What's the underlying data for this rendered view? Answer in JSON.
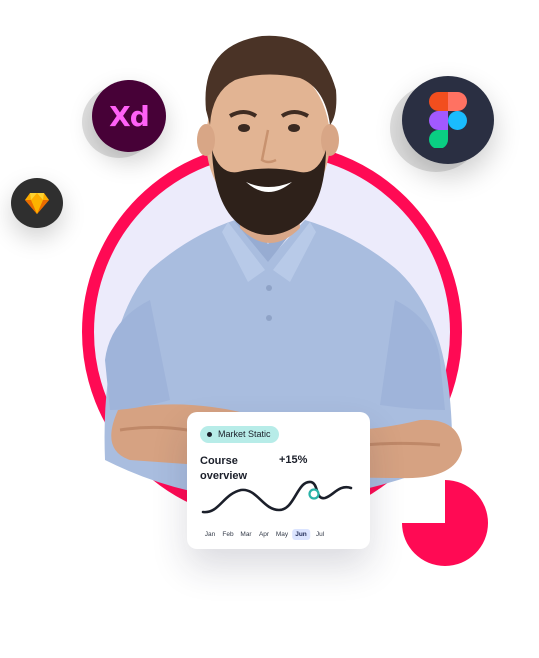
{
  "icons": {
    "xd": {
      "name": "adobe-xd-icon",
      "label": "Xd",
      "bg": "#470137",
      "fg": "#ff61f6"
    },
    "sketch": {
      "name": "sketch-icon",
      "bg": "#2f2f2f",
      "fg": "#fdad00"
    },
    "figma": {
      "name": "figma-icon",
      "bg": "#2a2f42"
    }
  },
  "colors": {
    "ring": "#ff0a54",
    "disc": "#ecebfb",
    "badge": "#b7ece8",
    "chart_line": "#1b1f2a",
    "chart_marker": "#2ab3a8"
  },
  "card": {
    "badge": "Market Static",
    "title": "Course overview",
    "change": "+15%",
    "months": [
      "Jan",
      "Feb",
      "Mar",
      "Apr",
      "May",
      "Jun",
      "Jul"
    ],
    "active_month": "Jun"
  }
}
